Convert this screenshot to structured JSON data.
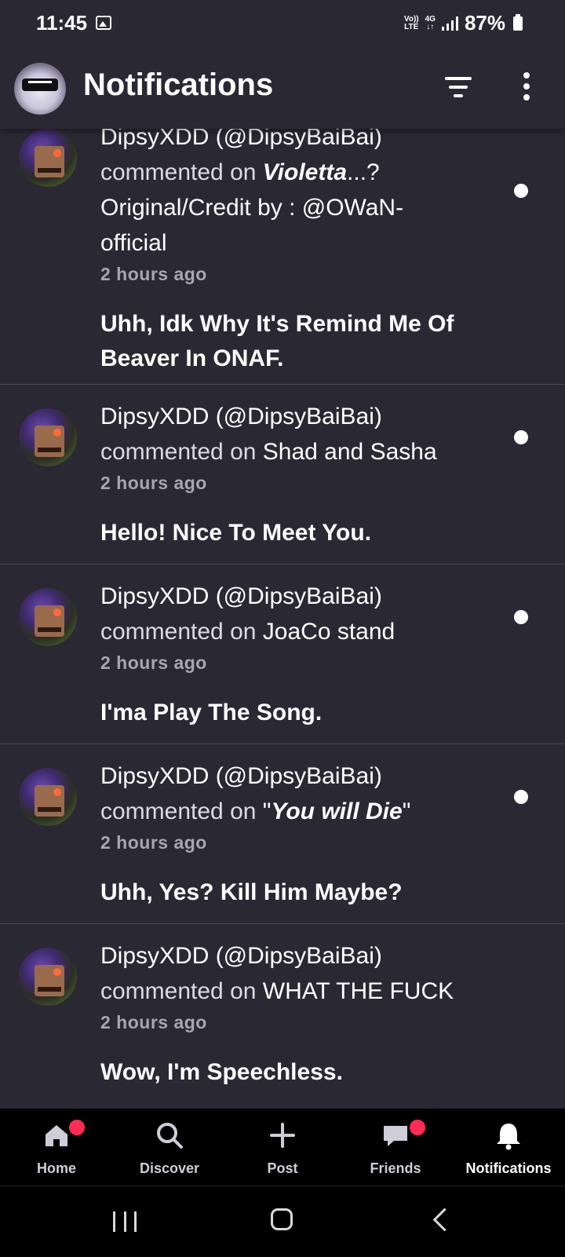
{
  "status_bar": {
    "time": "11:45",
    "network_volte": "Vo))",
    "network_lte": "LTE",
    "network_gen": "4G",
    "battery": "87%"
  },
  "header": {
    "title": "Notifications"
  },
  "notifications": [
    {
      "user": "DipsyXDD (@DipsyBaiBai)",
      "action": "commented on ",
      "target_bold_italic": "Violetta",
      "target_lines": [
        "...?",
        "Original/Credit by : @OWaN-",
        "official"
      ],
      "time": "2 hours ago",
      "comment_lines": [
        "Uhh, Idk Why It's Remind Me Of",
        "Beaver In ONAF."
      ],
      "unread": true
    },
    {
      "user": "DipsyXDD (@DipsyBaiBai)",
      "action": "commented on ",
      "target": "Shad and Sasha",
      "time": "2 hours ago",
      "comment": "Hello! Nice To Meet You.",
      "unread": true
    },
    {
      "user": "DipsyXDD (@DipsyBaiBai)",
      "action": "commented on ",
      "target": "JoaCo stand",
      "time": "2 hours ago",
      "comment": "I'ma Play The Song.",
      "unread": true
    },
    {
      "user": "DipsyXDD (@DipsyBaiBai)",
      "action": "commented on ",
      "target_prefix": "\"",
      "target_bold_italic": "You will Die",
      "target_suffix": "\"",
      "time": "2 hours ago",
      "comment": "Uhh, Yes? Kill Him Maybe?",
      "unread": true
    },
    {
      "user": "DipsyXDD (@DipsyBaiBai)",
      "action": "commented on ",
      "target": "WHAT THE FUCK",
      "time": "2 hours ago",
      "comment": "Wow, I'm Speechless.",
      "unread": false
    }
  ],
  "bottom_nav": [
    {
      "label": "Home",
      "icon": "home-icon",
      "badge": true
    },
    {
      "label": "Discover",
      "icon": "search-icon",
      "badge": false
    },
    {
      "label": "Post",
      "icon": "plus-icon",
      "badge": false
    },
    {
      "label": "Friends",
      "icon": "chat-bubble-icon",
      "badge": true
    },
    {
      "label": "Notifications",
      "icon": "bell-icon",
      "badge": false,
      "active": true
    }
  ],
  "colors": {
    "background": "#2a2832",
    "badge": "#ff2a55",
    "nav_background": "#000000"
  }
}
